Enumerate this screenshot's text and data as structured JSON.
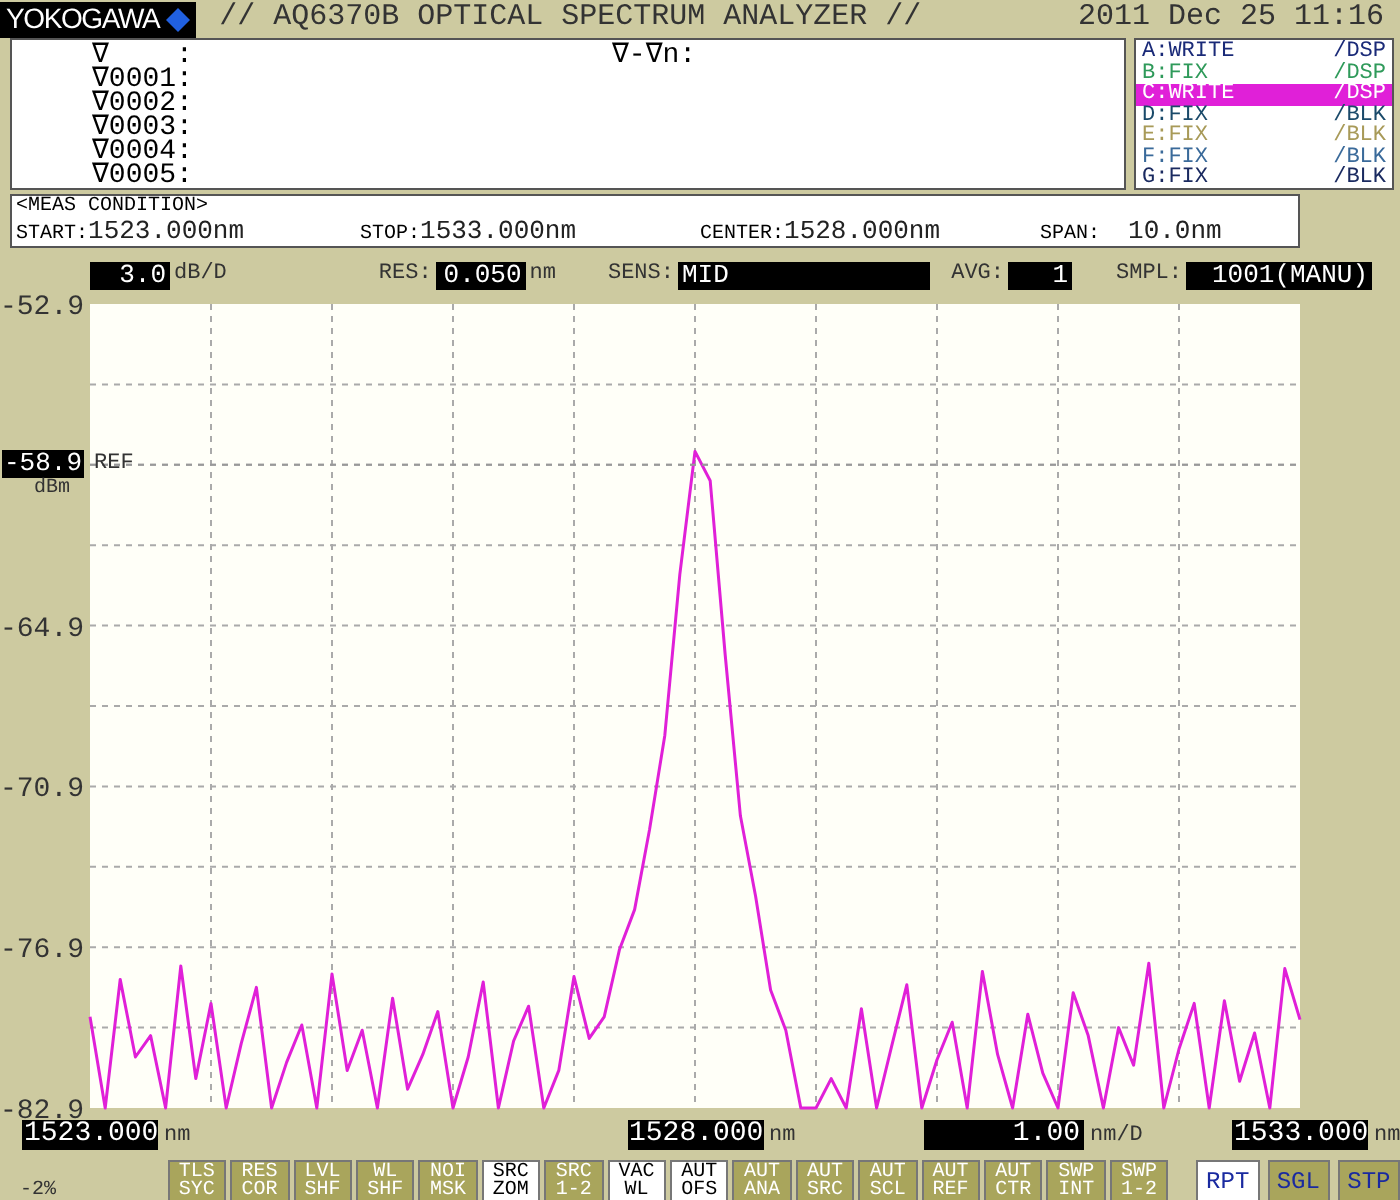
{
  "header": {
    "brand": "YOKOGAWA",
    "title": "// AQ6370B OPTICAL SPECTRUM ANALYZER //",
    "datetime": "2011 Dec 25 11:16"
  },
  "markers": {
    "labels": [
      "∇    :",
      "∇0001:",
      "∇0002:",
      "∇0003:",
      "∇0004:",
      "∇0005:"
    ],
    "difference": "∇-∇n:"
  },
  "traces": [
    {
      "name": "A:WRITE",
      "display": "/DSP",
      "color": "#1a2a78",
      "selected": false
    },
    {
      "name": "B:FIX",
      "display": "/DSP",
      "color": "#2f9a5a",
      "selected": false
    },
    {
      "name": "C:WRITE",
      "display": "/DSP",
      "color": "#e020d8",
      "selected": true
    },
    {
      "name": "D:FIX",
      "display": "/BLK",
      "color": "#1a4a6a",
      "selected": false
    },
    {
      "name": "E:FIX",
      "display": "/BLK",
      "color": "#a89a58",
      "selected": false
    },
    {
      "name": "F:FIX",
      "display": "/BLK",
      "color": "#3a6a9a",
      "selected": false
    },
    {
      "name": "G:FIX",
      "display": "/BLK",
      "color": "#1a2a60",
      "selected": false
    }
  ],
  "meas_condition": {
    "title": "<MEAS CONDITION>",
    "items": [
      {
        "label": "START:",
        "value": "1523.000nm"
      },
      {
        "label": "STOP:",
        "value": "1533.000nm"
      },
      {
        "label": "CENTER:",
        "value": "1528.000nm"
      },
      {
        "label": "SPAN:",
        "value": "10.0nm"
      }
    ]
  },
  "settings": [
    {
      "value": "3.0",
      "unit": "dB/D"
    },
    {
      "label": "RES:",
      "value": "0.050",
      "unit": "nm"
    },
    {
      "label": "SENS:",
      "value": "MID"
    },
    {
      "label": "AVG:",
      "value": "1"
    },
    {
      "label": "SMPL:",
      "value": "1001(MANU)"
    }
  ],
  "y_unit": "dBm",
  "chart_data": {
    "type": "line",
    "grid": true,
    "ref_lines": [
      {
        "axis": "y",
        "value": -58.9,
        "label": "REF"
      }
    ],
    "xlim": [
      1523,
      1533
    ],
    "ylim": [
      -82.9,
      -52.9
    ],
    "xticks": [
      {
        "value": 1523,
        "label": "1523.000"
      },
      {
        "value": 1528,
        "label": "1528.000"
      },
      {
        "value": 1533,
        "label": "1533.000"
      }
    ],
    "yticks": [
      {
        "value": -82.9,
        "label": "-82.9"
      },
      {
        "value": -76.9,
        "label": "-76.9"
      },
      {
        "value": -70.9,
        "label": "-70.9"
      },
      {
        "value": -64.9,
        "label": "-64.9"
      },
      {
        "value": -58.9,
        "label": "-58.9"
      },
      {
        "value": -52.9,
        "label": "-52.9"
      }
    ],
    "x": [
      1523,
      1523.125,
      1523.25,
      1523.375,
      1523.5,
      1523.625,
      1523.75,
      1523.875,
      1524,
      1524.125,
      1524.25,
      1524.375,
      1524.5,
      1524.625,
      1524.75,
      1524.875,
      1525,
      1525.125,
      1525.25,
      1525.375,
      1525.5,
      1525.625,
      1525.75,
      1525.875,
      1526,
      1526.125,
      1526.25,
      1526.375,
      1526.5,
      1526.625,
      1526.75,
      1526.875,
      1527,
      1527.125,
      1527.25,
      1527.375,
      1527.5,
      1527.625,
      1527.75,
      1527.875,
      1528,
      1528.125,
      1528.25,
      1528.375,
      1528.5,
      1528.625,
      1528.75,
      1528.875,
      1529,
      1529.125,
      1529.25,
      1529.375,
      1529.5,
      1529.625,
      1529.75,
      1529.875,
      1530,
      1530.125,
      1530.25,
      1530.375,
      1530.5,
      1530.625,
      1530.75,
      1530.875,
      1531,
      1531.125,
      1531.25,
      1531.375,
      1531.5,
      1531.625,
      1531.75,
      1531.875,
      1532,
      1532.125,
      1532.25,
      1532.375,
      1532.5,
      1532.625,
      1532.75,
      1532.875,
      1533
    ],
    "series": [
      {
        "color": "#e020d8",
        "values": [
          -79.5,
          -82.9,
          -78.1,
          -81.0,
          -80.2,
          -82.9,
          -77.6,
          -81.8,
          -79.0,
          -82.9,
          -80.5,
          -78.4,
          -82.9,
          -81.2,
          -79.8,
          -82.9,
          -77.9,
          -81.5,
          -80.0,
          -82.9,
          -78.8,
          -82.2,
          -80.9,
          -79.3,
          -82.9,
          -81.0,
          -78.2,
          -82.9,
          -80.4,
          -79.1,
          -82.9,
          -81.5,
          -78.0,
          -80.3,
          -79.5,
          -77.0,
          -75.5,
          -72.5,
          -69.0,
          -63.0,
          -58.4,
          -59.5,
          -66.0,
          -72.0,
          -75.0,
          -78.5,
          -80.0,
          -82.9,
          -82.9,
          -81.8,
          -82.9,
          -79.2,
          -82.9,
          -80.6,
          -78.3,
          -82.9,
          -81.1,
          -79.7,
          -82.9,
          -77.8,
          -80.9,
          -82.9,
          -79.4,
          -81.6,
          -82.9,
          -78.6,
          -80.2,
          -82.9,
          -79.9,
          -81.3,
          -77.5,
          -82.9,
          -80.7,
          -79.0,
          -82.9,
          -78.9,
          -81.9,
          -80.1,
          -82.9,
          -77.7,
          -79.6
        ]
      }
    ]
  },
  "x_units": [
    "nm",
    "nm",
    "nm"
  ],
  "scale": {
    "value": "1.00",
    "unit": "nm/D"
  },
  "indicator": "-2%",
  "softkeys": [
    {
      "kind": "soft",
      "lines": [
        "TLS",
        "SYC"
      ],
      "active": false
    },
    {
      "kind": "soft",
      "lines": [
        "RES",
        "COR"
      ],
      "active": false
    },
    {
      "kind": "soft",
      "lines": [
        "LVL",
        "SHF"
      ],
      "active": false
    },
    {
      "kind": "soft",
      "lines": [
        "WL",
        "SHF"
      ],
      "active": false
    },
    {
      "kind": "soft",
      "lines": [
        "NOI",
        "MSK"
      ],
      "active": false
    },
    {
      "kind": "soft",
      "lines": [
        "SRC",
        "ZOM"
      ],
      "active": true
    },
    {
      "kind": "soft",
      "lines": [
        "SRC",
        "1-2"
      ],
      "active": false
    },
    {
      "kind": "soft",
      "lines": [
        "VAC",
        "WL"
      ],
      "active": true
    },
    {
      "kind": "soft",
      "lines": [
        "AUT",
        "OFS"
      ],
      "active": true
    },
    {
      "kind": "soft",
      "lines": [
        "AUT",
        "ANA"
      ],
      "active": false
    },
    {
      "kind": "soft",
      "lines": [
        "AUT",
        "SRC"
      ],
      "active": false
    },
    {
      "kind": "soft",
      "lines": [
        "AUT",
        "SCL"
      ],
      "active": false
    },
    {
      "kind": "soft",
      "lines": [
        "AUT",
        "REF"
      ],
      "active": false
    },
    {
      "kind": "soft",
      "lines": [
        "AUT",
        "CTR"
      ],
      "active": false
    },
    {
      "kind": "soft",
      "lines": [
        "SWP",
        "INT"
      ],
      "active": false
    },
    {
      "kind": "soft",
      "lines": [
        "SWP",
        "1-2"
      ],
      "active": false
    },
    {
      "kind": "sweep",
      "lines": [
        "RPT"
      ],
      "active": true
    },
    {
      "kind": "sweep",
      "lines": [
        "SGL"
      ],
      "active": false
    },
    {
      "kind": "sweep",
      "lines": [
        "STP"
      ],
      "active": false
    }
  ]
}
